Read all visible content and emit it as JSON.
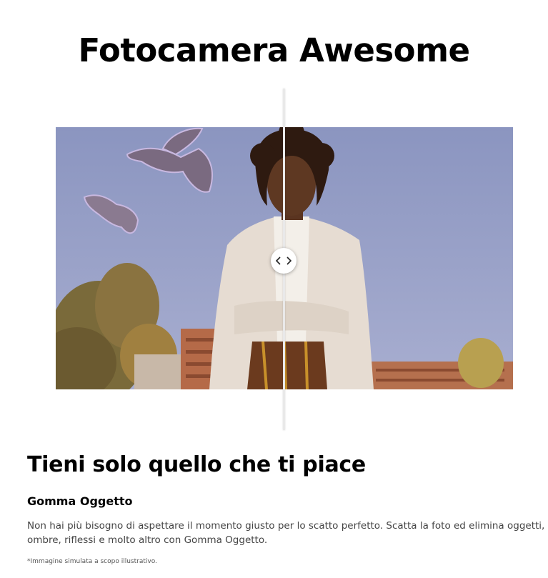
{
  "hero": {
    "title": "Fotocamera Awesome"
  },
  "comparison": {
    "handle_icon": "chevron-left-right-icon",
    "before_label": "",
    "after_label": ""
  },
  "section": {
    "title": "Tieni solo quello che ti piace",
    "feature_title": "Gomma Oggetto",
    "description": "Non hai più bisogno di aspettare il momento giusto per lo scatto perfetto. Scatta la foto ed elimina oggetti, ombre, riflessi e molto altro con Gomma Oggetto.",
    "disclaimer": "*Immagine simulata a scopo illustrativo."
  },
  "colors": {
    "sky": "#9aa3c9",
    "text": "#000000",
    "body_text": "#444444"
  }
}
